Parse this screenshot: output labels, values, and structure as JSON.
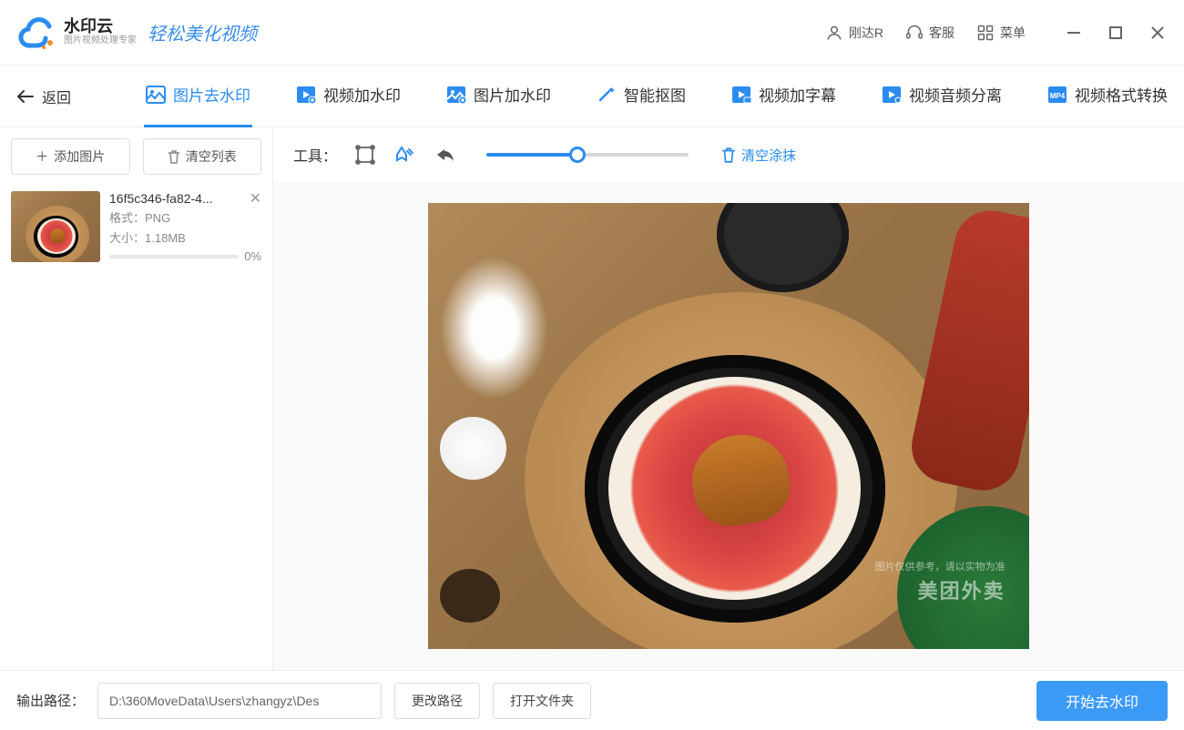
{
  "header": {
    "app_name": "水印云",
    "app_sub": "图片视频处理专家",
    "tagline": "轻松美化视频",
    "user_label": "刚达R",
    "support_label": "客服",
    "menu_label": "菜单"
  },
  "nav": {
    "back": "返回",
    "tabs": [
      {
        "label": "图片去水印",
        "active": true
      },
      {
        "label": "视频加水印",
        "active": false
      },
      {
        "label": "图片加水印",
        "active": false
      },
      {
        "label": "智能抠图",
        "active": false
      },
      {
        "label": "视频加字幕",
        "active": false
      },
      {
        "label": "视频音频分离",
        "active": false
      },
      {
        "label": "视频格式转换",
        "active": false
      }
    ]
  },
  "sidebar": {
    "add_image": "添加图片",
    "clear_list": "清空列表",
    "file": {
      "name": "16f5c346-fa82-4...",
      "format_label": "格式：",
      "format_value": "PNG",
      "size_label": "大小：",
      "size_value": "1.18MB",
      "progress": "0%"
    }
  },
  "toolbar": {
    "label": "工具：",
    "clear_brush": "清空涂抹",
    "slider_percent": 45
  },
  "preview": {
    "watermark_sub": "图片仅供参考，请以实物为准",
    "watermark": "美团外卖"
  },
  "footer": {
    "output_label": "输出路径：",
    "path": "D:\\360MoveData\\Users\\zhangyz\\Des",
    "change_path": "更改路径",
    "open_folder": "打开文件夹",
    "start": "开始去水印"
  }
}
